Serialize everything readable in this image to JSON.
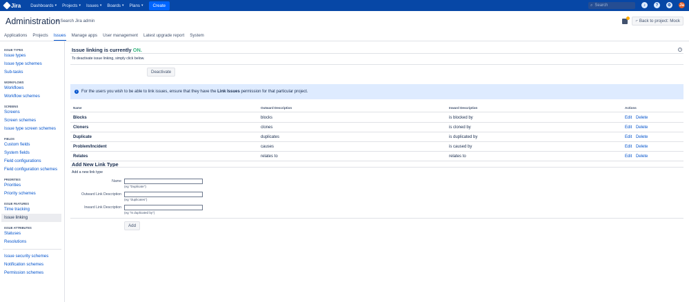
{
  "topbar": {
    "logo_text": "Jira",
    "nav": [
      "Dashboards",
      "Projects",
      "Issues",
      "Boards",
      "Plans"
    ],
    "create_label": "Create",
    "search_placeholder": "Search",
    "avatar_initials": "Ja"
  },
  "header": {
    "title": "Administration",
    "search_label": "Search Jira admin",
    "back_label": "Back to project: Mock"
  },
  "tabs": [
    "Applications",
    "Projects",
    "Issues",
    "Manage apps",
    "User management",
    "Latest upgrade report",
    "System"
  ],
  "sidebar": [
    {
      "title": "ISSUE TYPES",
      "items": [
        "Issue types",
        "Issue type schemes",
        "Sub-tasks"
      ]
    },
    {
      "title": "WORKFLOWS",
      "items": [
        "Workflows",
        "Workflow schemes"
      ]
    },
    {
      "title": "SCREENS",
      "items": [
        "Screens",
        "Screen schemes",
        "Issue type screen schemes"
      ]
    },
    {
      "title": "FIELDS",
      "items": [
        "Custom fields",
        "System fields",
        "Field configurations",
        "Field configuration schemes"
      ]
    },
    {
      "title": "PRIORITIES",
      "items": [
        "Priorities",
        "Priority schemes"
      ]
    },
    {
      "title": "ISSUE FEATURES",
      "items": [
        "Time tracking",
        "Issue linking"
      ]
    },
    {
      "title": "ISSUE ATTRIBUTES",
      "items": [
        "Statuses",
        "Resolutions"
      ]
    },
    {
      "title": "",
      "items": [
        "Issue security schemes",
        "Notification schemes",
        "Permission schemes"
      ]
    }
  ],
  "main": {
    "heading_prefix": "Issue linking is currently",
    "heading_status": "ON.",
    "subtext": "To deactivate issue linking, simply click below.",
    "deactivate_label": "Deactivate",
    "info_pre": "For the users you wish to be able to link issues, ensure that they have the",
    "info_bold": "Link Issues",
    "info_post": "permission for that particular project.",
    "table_headers": [
      "Name",
      "Outward Description",
      "Inward Description",
      "Actions"
    ],
    "rows": [
      {
        "name": "Blocks",
        "outward": "blocks",
        "inward": "is blocked by"
      },
      {
        "name": "Cloners",
        "outward": "clones",
        "inward": "is cloned by"
      },
      {
        "name": "Duplicate",
        "outward": "duplicates",
        "inward": "is duplicated by"
      },
      {
        "name": "Problem/Incident",
        "outward": "causes",
        "inward": "is caused by"
      },
      {
        "name": "Relates",
        "outward": "relates to",
        "inward": "relates to"
      }
    ],
    "edit_label": "Edit",
    "delete_label": "Delete",
    "add_title": "Add New Link Type",
    "add_sub": "Add a new link type",
    "fields": [
      {
        "label": "Name",
        "hint": "(eg \"Duplicate\")"
      },
      {
        "label": "Outward Link Description",
        "hint": "(eg \"duplicates\")"
      },
      {
        "label": "Inward Link Description",
        "hint": "(eg \"is duplicated by\")"
      }
    ],
    "add_button": "Add"
  }
}
